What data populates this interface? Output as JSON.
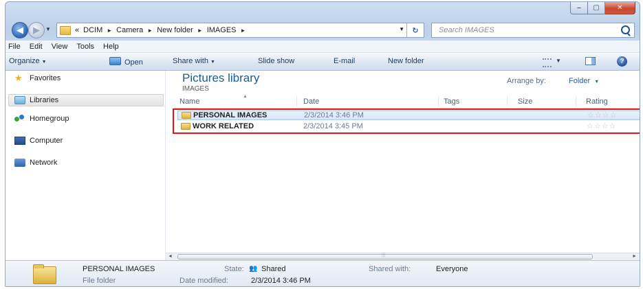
{
  "window": {
    "caption": {
      "minimize": "–",
      "maximize": "▢",
      "close": "✕"
    }
  },
  "address_bar": {
    "back": "◀",
    "forward": "▶",
    "overflow": "«",
    "crumbs": [
      "DCIM",
      "Camera",
      "New folder",
      "IMAGES"
    ],
    "separator": "►",
    "dropdown": "▼",
    "refresh": "↻"
  },
  "search": {
    "placeholder": "Search IMAGES"
  },
  "menu": [
    "File",
    "Edit",
    "View",
    "Tools",
    "Help"
  ],
  "command_bar": {
    "organize": "Organize",
    "open": "Open",
    "share_with": "Share with",
    "slide_show": "Slide show",
    "email": "E-mail",
    "new_folder": "New folder",
    "help": "?"
  },
  "nav_pane": {
    "favorites": "Favorites",
    "libraries": "Libraries",
    "homegroup": "Homegroup",
    "computer": "Computer",
    "network": "Network"
  },
  "library": {
    "title": "Pictures library",
    "subtitle": "IMAGES",
    "arrange_label": "Arrange by:",
    "arrange_value": "Folder"
  },
  "columns": [
    "Name",
    "Date",
    "Tags",
    "Size",
    "Rating"
  ],
  "rows": [
    {
      "name": "PERSONAL IMAGES",
      "date": "2/3/2014 3:46 PM",
      "rating": "☆☆☆☆"
    },
    {
      "name": "WORK RELATED",
      "date": "2/3/2014 3:45 PM",
      "rating": "☆☆☆☆"
    }
  ],
  "details": {
    "name": "PERSONAL IMAGES",
    "type": "File folder",
    "state_label": "State:",
    "state_value": "Shared",
    "modified_label": "Date modified:",
    "modified_value": "2/3/2014 3:46 PM",
    "shared_with_label": "Shared with:",
    "shared_with_value": "Everyone"
  },
  "colors": {
    "highlight_border": "#e3141b",
    "library_title": "#1e5a8c",
    "selected_row": "#d6e7fb"
  }
}
